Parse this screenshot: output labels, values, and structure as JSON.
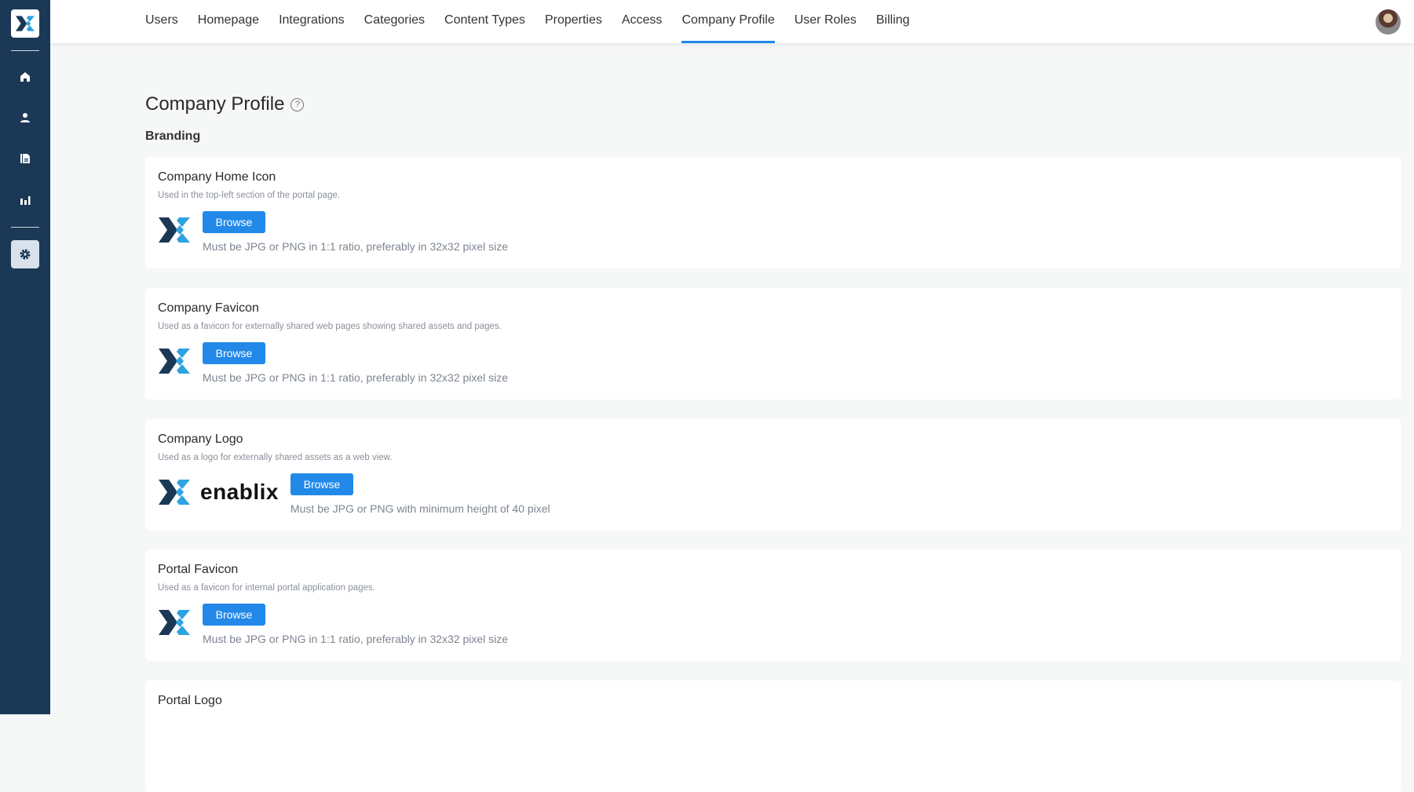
{
  "nav": {
    "tabs": [
      "Users",
      "Homepage",
      "Integrations",
      "Categories",
      "Content Types",
      "Properties",
      "Access",
      "Company Profile",
      "User Roles",
      "Billing"
    ],
    "active": "Company Profile"
  },
  "page": {
    "title": "Company Profile",
    "help": "?",
    "section": "Branding"
  },
  "cards": [
    {
      "title": "Company Home Icon",
      "desc": "Used in the top-left section of the portal page.",
      "button": "Browse",
      "hint": "Must be JPG or PNG in 1:1 ratio, preferably in 32x32 pixel size"
    },
    {
      "title": "Company Favicon",
      "desc": "Used as a favicon for externally shared web pages showing shared assets and pages.",
      "button": "Browse",
      "hint": "Must be JPG or PNG in 1:1 ratio, preferably in 32x32 pixel size"
    },
    {
      "title": "Company Logo",
      "desc": "Used as a logo for externally shared assets as a web view.",
      "button": "Browse",
      "hint": "Must be JPG or PNG with minimum height of 40 pixel",
      "brand": "enablix"
    },
    {
      "title": "Portal Favicon",
      "desc": "Used as a favicon for internal portal application pages.",
      "button": "Browse",
      "hint": "Must be JPG or PNG in 1:1 ratio, preferably in 32x32 pixel size"
    },
    {
      "title": "Portal Logo"
    }
  ],
  "colors": {
    "sidebar": "#1b3857",
    "accent": "#2289e8",
    "logo_dark": "#1b3857",
    "logo_light": "#2ea3e0"
  }
}
